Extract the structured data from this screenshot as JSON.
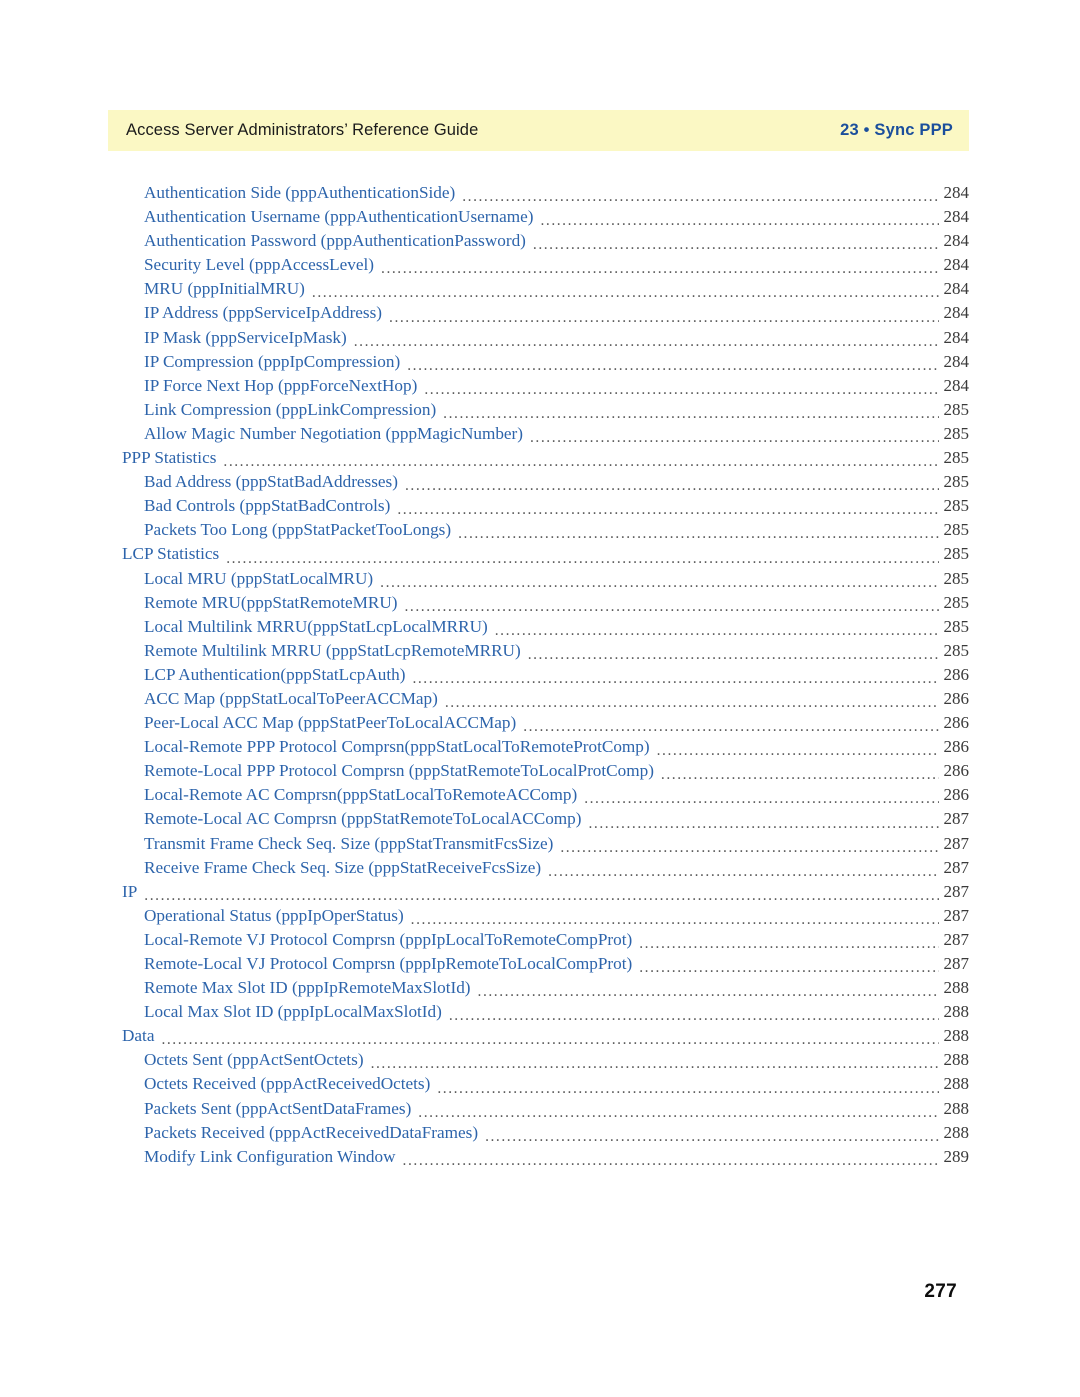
{
  "header": {
    "left_text": "Access Server Administrators’ Reference Guide",
    "right_text": "23 • Sync PPP",
    "band_color": "#fbf8c4",
    "right_text_color": "#1b4f9c"
  },
  "folio": {
    "page_number": "277"
  },
  "toc": {
    "entry_color": "#2d64ab",
    "page_number_color": "#3a3a3a",
    "entries": [
      {
        "title": "Authentication Side (pppAuthenticationSide)",
        "page": "284",
        "level": 2
      },
      {
        "title": "Authentication Username (pppAuthenticationUsername)",
        "page": "284",
        "level": 2
      },
      {
        "title": "Authentication Password (pppAuthenticationPassword)",
        "page": "284",
        "level": 2
      },
      {
        "title": "Security Level (pppAccessLevel)",
        "page": "284",
        "level": 2
      },
      {
        "title": "MRU (pppInitialMRU)",
        "page": "284",
        "level": 2
      },
      {
        "title": "IP Address (pppServiceIpAddress)",
        "page": "284",
        "level": 2
      },
      {
        "title": "IP Mask (pppServiceIpMask)",
        "page": "284",
        "level": 2
      },
      {
        "title": "IP Compression (pppIpCompression)",
        "page": "284",
        "level": 2
      },
      {
        "title": "IP Force Next Hop (pppForceNextHop)",
        "page": "284",
        "level": 2
      },
      {
        "title": "Link Compression (pppLinkCompression)",
        "page": "285",
        "level": 2
      },
      {
        "title": "Allow Magic Number Negotiation (pppMagicNumber)",
        "page": "285",
        "level": 2
      },
      {
        "title": "PPP Statistics",
        "page": "285",
        "level": 1
      },
      {
        "title": "Bad Address (pppStatBadAddresses)",
        "page": "285",
        "level": 2
      },
      {
        "title": "Bad Controls (pppStatBadControls)",
        "page": "285",
        "level": 2
      },
      {
        "title": "Packets Too Long (pppStatPacketTooLongs)",
        "page": "285",
        "level": 2
      },
      {
        "title": "LCP Statistics",
        "page": "285",
        "level": 1
      },
      {
        "title": "Local MRU (pppStatLocalMRU)",
        "page": "285",
        "level": 2
      },
      {
        "title": "Remote MRU(pppStatRemoteMRU)",
        "page": "285",
        "level": 2
      },
      {
        "title": "Local Multilink MRRU(pppStatLcpLocalMRRU)",
        "page": "285",
        "level": 2
      },
      {
        "title": "Remote Multilink MRRU (pppStatLcpRemoteMRRU)",
        "page": "285",
        "level": 2
      },
      {
        "title": "LCP Authentication(pppStatLcpAuth)",
        "page": "286",
        "level": 2
      },
      {
        "title": "ACC Map (pppStatLocalToPeerACCMap)",
        "page": "286",
        "level": 2
      },
      {
        "title": "Peer-Local ACC Map (pppStatPeerToLocalACCMap)",
        "page": "286",
        "level": 2
      },
      {
        "title": "Local-Remote PPP Protocol Comprsn(pppStatLocalToRemoteProtComp)",
        "page": "286",
        "level": 2
      },
      {
        "title": "Remote-Local PPP Protocol Comprsn (pppStatRemoteToLocalProtComp)",
        "page": "286",
        "level": 2
      },
      {
        "title": "Local-Remote AC Comprsn(pppStatLocalToRemoteACComp)",
        "page": "286",
        "level": 2
      },
      {
        "title": "Remote-Local AC Comprsn (pppStatRemoteToLocalACComp)",
        "page": "287",
        "level": 2
      },
      {
        "title": "Transmit Frame Check Seq. Size (pppStatTransmitFcsSize)",
        "page": "287",
        "level": 2
      },
      {
        "title": "Receive Frame Check Seq. Size (pppStatReceiveFcsSize)",
        "page": "287",
        "level": 2
      },
      {
        "title": "IP",
        "page": "287",
        "level": 1
      },
      {
        "title": "Operational Status (pppIpOperStatus)",
        "page": "287",
        "level": 2
      },
      {
        "title": "Local-Remote VJ Protocol Comprsn (pppIpLocalToRemoteCompProt)",
        "page": "287",
        "level": 2
      },
      {
        "title": "Remote-Local VJ Protocol Comprsn (pppIpRemoteToLocalCompProt)",
        "page": "287",
        "level": 2
      },
      {
        "title": "Remote Max Slot ID (pppIpRemoteMaxSlotId)",
        "page": "288",
        "level": 2
      },
      {
        "title": "Local Max Slot ID (pppIpLocalMaxSlotId)",
        "page": "288",
        "level": 2
      },
      {
        "title": "Data",
        "page": "288",
        "level": 1
      },
      {
        "title": "Octets Sent (pppActSentOctets)",
        "page": "288",
        "level": 2
      },
      {
        "title": "Octets Received (pppActReceivedOctets)",
        "page": "288",
        "level": 2
      },
      {
        "title": "Packets Sent (pppActSentDataFrames)",
        "page": "288",
        "level": 2
      },
      {
        "title": "Packets Received (pppActReceivedDataFrames)",
        "page": "288",
        "level": 2
      },
      {
        "title": "Modify Link Configuration Window",
        "page": "289",
        "level": 2
      }
    ]
  }
}
